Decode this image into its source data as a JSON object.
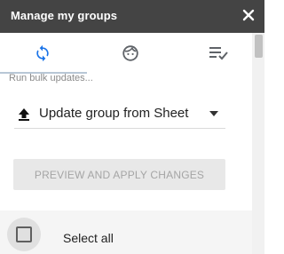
{
  "header": {
    "title": "Manage my groups",
    "close_icon": "close-icon"
  },
  "tabs": [
    {
      "icon": "sync-icon",
      "active": true
    },
    {
      "icon": "face-icon",
      "active": false
    },
    {
      "icon": "playlist-check-icon",
      "active": false
    }
  ],
  "colors": {
    "header_bg": "#444444",
    "accent": "#1a73e8",
    "icon": "#5f6368",
    "tab_indicator": "#b8c7d6"
  },
  "main": {
    "hint_text": "Run bulk updates...",
    "action_select": {
      "icon": "upload-icon",
      "selected": "Update group from Sheet"
    },
    "preview_button_label": "PREVIEW AND APPLY CHANGES",
    "select_all_label": "Select all"
  }
}
